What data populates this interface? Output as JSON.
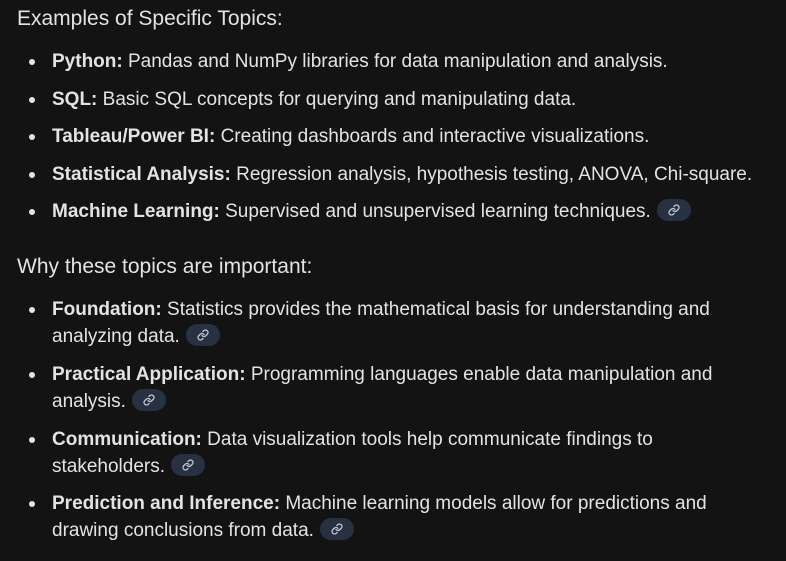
{
  "section1": {
    "heading": "Examples of Specific Topics:",
    "items": [
      {
        "label": "Python:",
        "text": " Pandas and NumPy libraries for data manipulation and analysis."
      },
      {
        "label": "SQL:",
        "text": " Basic SQL concepts for querying and manipulating data."
      },
      {
        "label": "Tableau/Power BI:",
        "text": " Creating dashboards and interactive visualizations."
      },
      {
        "label": "Statistical Analysis:",
        "text": " Regression analysis, hypothesis testing, ANOVA, Chi-square."
      },
      {
        "label": "Machine Learning:",
        "text": " Supervised and unsupervised learning techniques."
      }
    ]
  },
  "section2": {
    "heading": "Why these topics are important:",
    "items": [
      {
        "label": "Foundation:",
        "line1": " Statistics provides the mathematical basis for understanding and",
        "line2": "analyzing data."
      },
      {
        "label": "Practical Application:",
        "line1": " Programming languages enable data manipulation and",
        "line2": "analysis."
      },
      {
        "label": "Communication:",
        "line1": " Data visualization tools help communicate findings to",
        "line2": "stakeholders."
      },
      {
        "label": "Prediction and Inference:",
        "line1": " Machine learning models allow for predictions and",
        "line2": "drawing conclusions from data."
      }
    ]
  },
  "icons": {
    "citation": "link-icon"
  },
  "colors": {
    "background": "#131314",
    "text": "#e3e3e3",
    "citation_chip": "#283142",
    "citation_icon": "#c2c7d0"
  }
}
